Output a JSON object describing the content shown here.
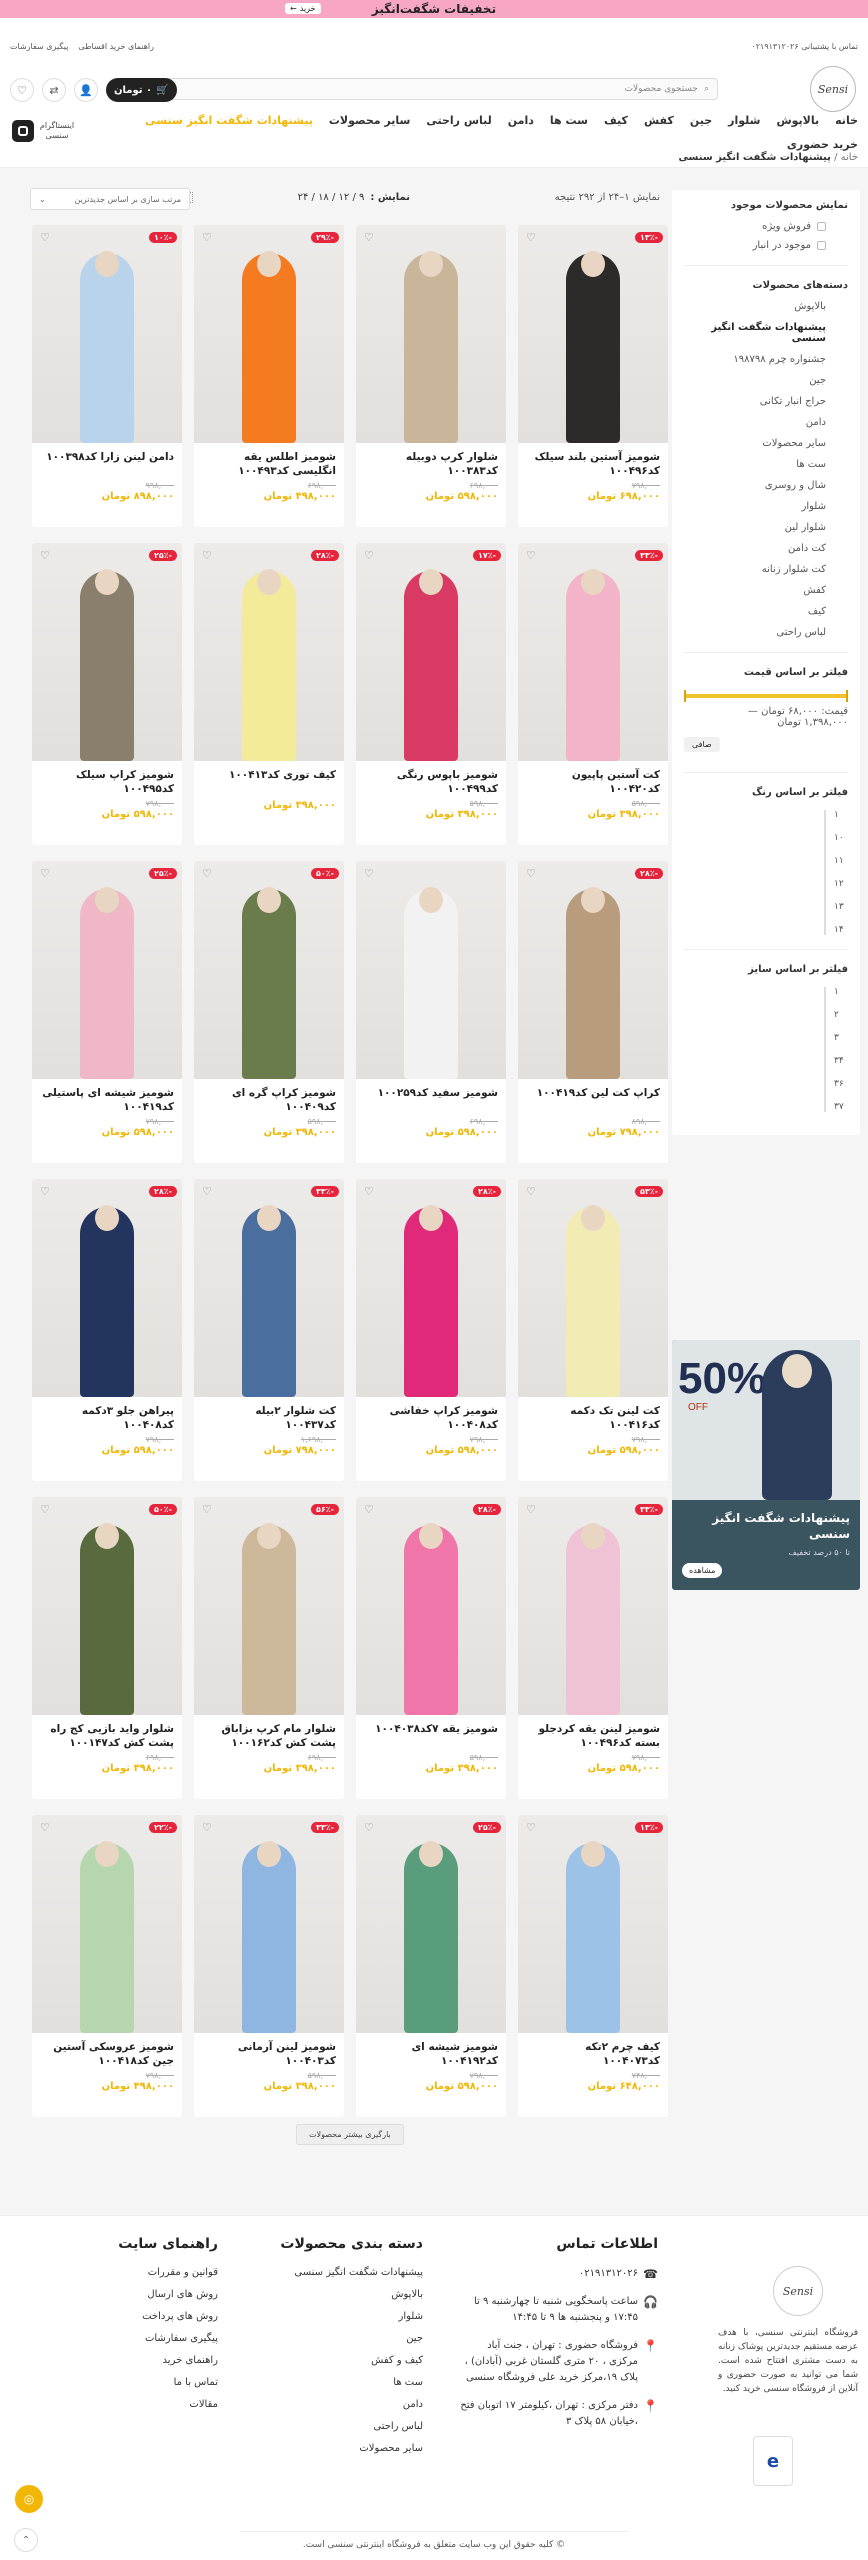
{
  "topbar": {
    "text": "تخفیفات شگفت‌انگیز",
    "buy": "خرید",
    "arrow": "←"
  },
  "util": {
    "phone": "تماس با پشتیبانی ۰۲۱۹۱۳۱۲۰۲۶",
    "links": [
      "راهنمای خرید اقساطی",
      "پیگیری سفارشات"
    ]
  },
  "logo": "Sensi",
  "search": {
    "placeholder": "جستجوی محصولات"
  },
  "cart": {
    "label": "۰ تومان"
  },
  "nav": {
    "items": [
      "خانه",
      "بالاپوش",
      "شلوار",
      "جین",
      "کفش",
      "کیف",
      "ست ها",
      "دامن",
      "لباس راحتی",
      "سایر محصولات"
    ],
    "highlight": "پیشنهادات شگفت انگیز سنسی",
    "second": "خرید حضوری"
  },
  "insta": {
    "label": "اینستاگرام سنسی"
  },
  "breadcrumb": {
    "home": "خانه",
    "current": "پیشنهادات شگفت انگیز سنسی"
  },
  "sidebar": {
    "stock_title": "نمایش محصولات موجود",
    "stock_opts": [
      "فروش ویژه",
      "موجود در انبار"
    ],
    "cat_title": "دسته‌های محصولات",
    "cats": [
      "بالاپوش",
      "پیشنهادات شگفت انگیز سنسی",
      "جشنواره چرم ۱۹۸۷۹۸",
      "جین",
      "حراج انبار تکانی",
      "دامن",
      "سایر محصولات",
      "ست ها",
      "شال و روسری",
      "شلوار",
      "شلوار لین",
      "کت دامن",
      "کت شلوار زنانه",
      "کفش",
      "کیف",
      "لباس راحتی"
    ],
    "price_title": "فیلتر بر اساس قیمت",
    "price_label": "قیمت:",
    "price_min": "۶۸,۰۰۰ تومان —",
    "price_max": "۱,۳۹۸,۰۰۰ تومان",
    "filter_btn": "صافی",
    "color_title": "فیلتر بر اساس رنگ",
    "colors": [
      "۱",
      "۱۰",
      "۱۱",
      "۱۲",
      "۱۳",
      "۱۴"
    ],
    "size_title": "فیلتر بر اساس سایز",
    "sizes": [
      "۱",
      "۲",
      "۳",
      "۳۴",
      "۳۶",
      "۳۷"
    ]
  },
  "banner": {
    "pct": "50%",
    "off": "OFF",
    "title": "پیشنهادات شگفت انگیز سنسی",
    "sub": "تا ۵۰ درصد تخفیف",
    "btn": "مشاهده"
  },
  "toolbar": {
    "result": "نمایش ۱–۲۴ از ۲۹۲ نتیجه",
    "show_label": "نمایش :",
    "show_opts": "۹ / ۱۲ / ۱۸ / ۲۴",
    "sort": "مرتب سازی بر اساس جدیدترین"
  },
  "products": [
    {
      "name": "شومیز آستین بلند سیلک کد۱۰۰۴۹۶",
      "old": "۷۹۸,۰۰۰",
      "new": "۶۹۸,۰۰۰ تومان",
      "disc": "-۱۳٪",
      "color": "#2d2a2a"
    },
    {
      "name": "شلوار کرپ دوبیله کد۱۰۰۳۸۳",
      "old": "۶۹۸,۰۰۰",
      "new": "۵۹۸,۰۰۰ تومان",
      "disc": "",
      "color": "#c8b59a"
    },
    {
      "name": "شومیز اطلس یقه انگلیسی کد۱۰۰۴۹۳",
      "old": "۶۹۸,۰۰۰",
      "new": "۴۹۸,۰۰۰ تومان",
      "disc": "-۲۹٪",
      "color": "#f47b20"
    },
    {
      "name": "دامن لینن زارا کد۱۰۰۳۹۸",
      "old": "۹۹۸,۰۰۰",
      "new": "۸۹۸,۰۰۰ تومان",
      "disc": "-۱۰٪",
      "color": "#b9d3ec"
    },
    {
      "name": "کت آستین پاپیون کد۱۰۰۴۲۰",
      "old": "۵۹۸,۰۰۰",
      "new": "۳۹۸,۰۰۰ تومان",
      "disc": "-۳۳٪",
      "color": "#f3b3c9"
    },
    {
      "name": "شومیز باپوس رنگی کد۱۰۰۴۹۹",
      "old": "۵۹۸,۰۰۰",
      "new": "۳۹۸,۰۰۰ تومان",
      "disc": "-۱۷٪",
      "color": "#d83a64"
    },
    {
      "name": "کیف توری کد۱۰۰۴۱۳",
      "old": "",
      "new": "۳۹۸,۰۰۰ تومان",
      "disc": "-۲۸٪",
      "color": "#f3eb9a"
    },
    {
      "name": "شومیز کراپ سیلک کد۱۰۰۴۹۵",
      "old": "۷۹۸,۰۰۰",
      "new": "۵۹۸,۰۰۰ تومان",
      "disc": "-۲۵٪",
      "color": "#8a7f6c"
    },
    {
      "name": "کراپ کت لین کد۱۰۰۴۱۹",
      "old": "۸۹۸,۰۰۰",
      "new": "۷۹۸,۰۰۰ تومان",
      "disc": "-۲۸٪",
      "color": "#b79c7d"
    },
    {
      "name": "شومیز سفید کد۱۰۰۲۵۹",
      "old": "۶۹۸,۰۰۰",
      "new": "۵۹۸,۰۰۰ تومان",
      "disc": "",
      "color": "#f2f2f2"
    },
    {
      "name": "شومیز کراپ گره ای کد۱۰۰۴۰۹",
      "old": "۵۹۸,۰۰۰",
      "new": "۳۹۸,۰۰۰ تومان",
      "disc": "-۵۰٪",
      "color": "#6a7c4b"
    },
    {
      "name": "شومیز شیشه ای پاستیلی کد۱۰۰۴۱۹",
      "old": "۷۹۸,۰۰۰",
      "new": "۵۹۸,۰۰۰ تومان",
      "disc": "-۲۵٪",
      "color": "#f0b8c6"
    },
    {
      "name": "کت لینن تک دکمه کد۱۰۰۴۱۶",
      "old": "۷۹۸,۰۰۰",
      "new": "۵۹۸,۰۰۰ تومان",
      "disc": "-۵۳٪",
      "color": "#f2ecb4"
    },
    {
      "name": "شومیز کراپ خفاشی کد۱۰۰۴۰۸",
      "old": "۷۹۸,۰۰۰",
      "new": "۵۹۸,۰۰۰ تومان",
      "disc": "-۲۸٪",
      "color": "#e02a79"
    },
    {
      "name": "کت شلوار ۲بیله کد۱۰۰۴۳۷",
      "old": "۱,۶۹۸,۰۰۰",
      "new": "۷۹۸,۰۰۰ تومان",
      "disc": "-۳۳٪",
      "color": "#4a6e9e"
    },
    {
      "name": "پیراهن جلو ۳دکمه کد۱۰۰۴۰۸",
      "old": "۷۹۸,۰۰۰",
      "new": "۵۹۸,۰۰۰ تومان",
      "disc": "-۲۸٪",
      "color": "#23345f"
    },
    {
      "name": "شومیز لینن یقه کردجلو بسته کد۱۰۰۴۹۶",
      "old": "۷۹۸,۰۰۰",
      "new": "۵۹۸,۰۰۰ تومان",
      "disc": "-۳۳٪",
      "color": "#efc3d5"
    },
    {
      "name": "شومیز یقه ۷کد۱۰۰۴۰۳۸",
      "old": "۵۹۸,۰۰۰",
      "new": "۳۹۸,۰۰۰ تومان",
      "disc": "-۲۸٪",
      "color": "#f075a8"
    },
    {
      "name": "شلوار مام کرپ بزاباق پشت کش کد۱۰۰۱۶۲",
      "old": "۶۹۸,۰۰۰",
      "new": "۳۹۸,۰۰۰ تومان",
      "disc": "-۵۶٪",
      "color": "#cdb89b"
    },
    {
      "name": "شلوار واید بازیی کج راه پشت کش کد۱۰۰۱۴۷",
      "old": "۶۹۸,۰۰۰",
      "new": "۳۹۸,۰۰۰ تومان",
      "disc": "-۵۰٪",
      "color": "#596a3e"
    },
    {
      "name": "کیف چرم ۲تکه کد۱۰۰۴۰۷۳",
      "old": "۷۴۸,۰۰۰",
      "new": "۶۴۸,۰۰۰ تومان",
      "disc": "-۱۳٪",
      "color": "#9cc2e8"
    },
    {
      "name": "شومیز شیشه ای کد۱۰۰۴۱۹۲",
      "old": "۷۹۸,۰۰۰",
      "new": "۵۹۸,۰۰۰ تومان",
      "disc": "-۲۵٪",
      "color": "#5a9d7c"
    },
    {
      "name": "شومیز لینن آرمانی کد۱۰۰۴۰۳",
      "old": "۵۹۸,۰۰۰",
      "new": "۳۹۸,۰۰۰ تومان",
      "disc": "-۳۳٪",
      "color": "#8eb6e0"
    },
    {
      "name": "شومیز عروسکی آستین جین کد۱۰۰۴۱۸",
      "old": "۷۹۸,۰۰۰",
      "new": "۴۹۸,۰۰۰ تومان",
      "disc": "-۲۲٪",
      "color": "#b6d6b0"
    }
  ],
  "loadmore": "بارگیری بیشتر محصولات",
  "footer": {
    "about": "فروشگاه اینترنتی سنسی، با هدف عرضه مستقیم جدیدترین پوشاک زنانه به دست مشتری افتتاح شده است. شما می توانید به صورت حضوری و آنلاین از فروشگاه سنسی خرید کنید.",
    "contact_title": "اطلاعات تماس",
    "phone": "۰۲۱۹۱۳۱۲۰۲۶",
    "hours": "ساعت پاسخگویی شنبه تا چهارشنبه ۹ تا ۱۷:۴۵ و پنجشنبه ها ۹ تا ۱۴:۴۵",
    "store": "فروشگاه حضوری : تهران ، جنت آباد مرکزی ، ۲۰ متری گلستان غربی (آبادان) ، پلاک ۱۹،مرکز خرید علی فروشگاه سنسی",
    "office": "دفتر مرکزی : تهران ،کیلومتر ۱۷ اتوبان فتح ،خیابان ۵۸ پلاک ۳",
    "cat_title": "دسته بندی محصولات",
    "cats": [
      "پیشنهادات شگفت انگیز سنسی",
      "بالاپوش",
      "شلوار",
      "جین",
      "کیف و کفش",
      "ست ها",
      "دامن",
      "لباس راحتی",
      "سایر محصولات"
    ],
    "guide_title": "راهنمای سایت",
    "guides": [
      "قوانین و مقررات",
      "روش های ارسال",
      "روش های پرداخت",
      "پیگیری سفارشات",
      "راهنمای خرید",
      "تماس با ما",
      "مقالات"
    ],
    "copyright": "© کلیه حقوق این وب سایت متعلق به فروشگاه اینترنتی سنسی است."
  }
}
